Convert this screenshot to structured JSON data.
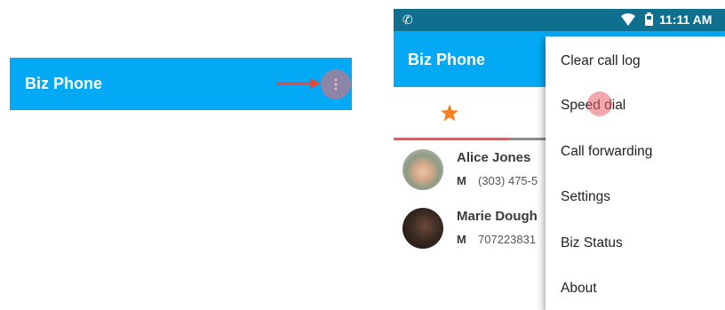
{
  "left_panel": {
    "app_title": "Biz Phone",
    "overflow_icon": "more-vert-icon",
    "arrow_icon": "right-arrow-icon",
    "arrow_color": "#e8473d"
  },
  "phone": {
    "status_bar": {
      "time": "11:11 AM",
      "icons": [
        "phone-call-icon",
        "wifi-icon",
        "battery-icon"
      ]
    },
    "app_bar": {
      "title": "Biz Phone"
    },
    "tabs": [
      {
        "icon": "star-icon",
        "selected": true
      }
    ],
    "contacts": [
      {
        "name": "Alice Jones",
        "type": "M",
        "number": "(303) 475-5"
      },
      {
        "name": "Marie Dough",
        "type": "M",
        "number": "707223831"
      }
    ],
    "overflow_menu": {
      "items": [
        {
          "label": "Clear call log"
        },
        {
          "label": "Speed dial"
        },
        {
          "label": "Call forwarding"
        },
        {
          "label": "Settings"
        },
        {
          "label": "Biz Status"
        },
        {
          "label": "About"
        }
      ],
      "touched_item": "Speed dial"
    }
  },
  "colors": {
    "app_bar": "#03a9f4",
    "status_bar": "#0f6f8e",
    "tab_indicator": "#f4525b",
    "star": "#f58220",
    "touch_indicator": "#e9606e"
  }
}
